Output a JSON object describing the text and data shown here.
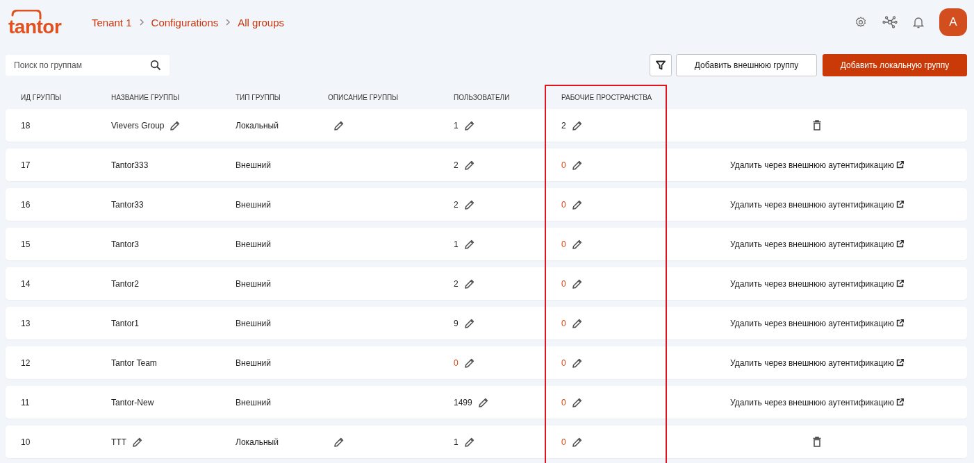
{
  "logo": "tantor",
  "breadcrumbs": [
    "Tenant 1",
    "Configurations",
    "All groups"
  ],
  "user": {
    "initial": "A"
  },
  "search": {
    "placeholder": "Поиск по группам"
  },
  "buttons": [
    {
      "label": "Добавить внешнюю группу",
      "kind": "secondary"
    },
    {
      "label": "Добавить локальную группу",
      "kind": "primary"
    }
  ],
  "table": {
    "columns": [
      {
        "label": "ИД ГРУППЫ",
        "highlighted": false
      },
      {
        "label": "НАЗВАНИЕ ГРУППЫ",
        "highlighted": false
      },
      {
        "label": "ТИП ГРУППЫ",
        "highlighted": false
      },
      {
        "label": "ОПИСАНИЕ ГРУППЫ",
        "highlighted": false
      },
      {
        "label": "ПОЛЬЗОВАТЕЛИ",
        "highlighted": false
      },
      {
        "label": "РАБОЧИЕ ПРОСТРАНСТВА",
        "highlighted": true
      }
    ],
    "rows": [
      {
        "id": "18",
        "name": "Vievers Group",
        "editable": true,
        "type": "Локальный",
        "users": {
          "value": "1",
          "alert": false
        },
        "workspaces": {
          "value": "2",
          "alert": false
        },
        "action": {
          "kind": "delete"
        }
      },
      {
        "id": "17",
        "name": "Tantor333",
        "editable": false,
        "type": "Внешний",
        "users": {
          "value": "2",
          "alert": false
        },
        "workspaces": {
          "value": "0",
          "alert": true
        },
        "action": {
          "kind": "external",
          "label": "Удалить через внешнюю аутентификацию"
        }
      },
      {
        "id": "16",
        "name": "Tantor33",
        "editable": false,
        "type": "Внешний",
        "users": {
          "value": "2",
          "alert": false
        },
        "workspaces": {
          "value": "0",
          "alert": true
        },
        "action": {
          "kind": "external",
          "label": "Удалить через внешнюю аутентификацию"
        }
      },
      {
        "id": "15",
        "name": "Tantor3",
        "editable": false,
        "type": "Внешний",
        "users": {
          "value": "1",
          "alert": false
        },
        "workspaces": {
          "value": "0",
          "alert": true
        },
        "action": {
          "kind": "external",
          "label": "Удалить через внешнюю аутентификацию"
        }
      },
      {
        "id": "14",
        "name": "Tantor2",
        "editable": false,
        "type": "Внешний",
        "users": {
          "value": "2",
          "alert": false
        },
        "workspaces": {
          "value": "0",
          "alert": true
        },
        "action": {
          "kind": "external",
          "label": "Удалить через внешнюю аутентификацию"
        }
      },
      {
        "id": "13",
        "name": "Tantor1",
        "editable": false,
        "type": "Внешний",
        "users": {
          "value": "9",
          "alert": false
        },
        "workspaces": {
          "value": "0",
          "alert": true
        },
        "action": {
          "kind": "external",
          "label": "Удалить через внешнюю аутентификацию"
        }
      },
      {
        "id": "12",
        "name": "Tantor Team",
        "editable": false,
        "type": "Внешний",
        "users": {
          "value": "0",
          "alert": true
        },
        "workspaces": {
          "value": "0",
          "alert": true
        },
        "action": {
          "kind": "external",
          "label": "Удалить через внешнюю аутентификацию"
        }
      },
      {
        "id": "11",
        "name": "Tantor-New",
        "editable": false,
        "type": "Внешний",
        "users": {
          "value": "1499",
          "alert": false
        },
        "workspaces": {
          "value": "0",
          "alert": true
        },
        "action": {
          "kind": "external",
          "label": "Удалить через внешнюю аутентификацию"
        }
      },
      {
        "id": "10",
        "name": "TTT",
        "editable": true,
        "type": "Локальный",
        "users": {
          "value": "1",
          "alert": false
        },
        "workspaces": {
          "value": "0",
          "alert": true
        },
        "action": {
          "kind": "delete"
        }
      }
    ]
  }
}
